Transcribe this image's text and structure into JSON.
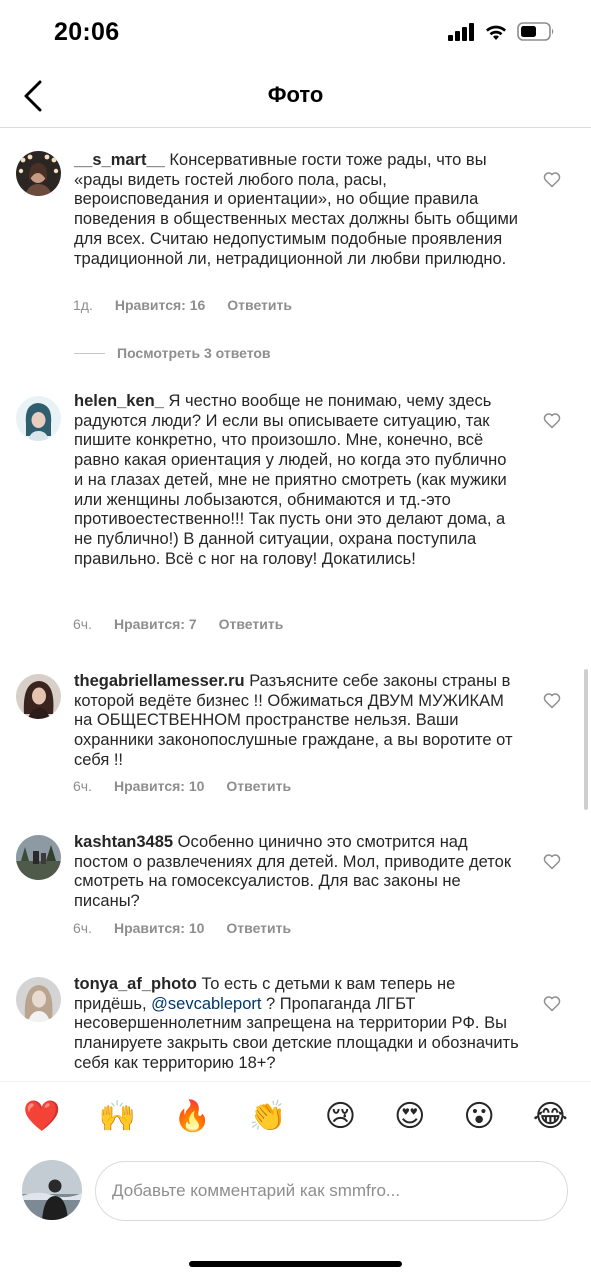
{
  "status_bar": {
    "time": "20:06"
  },
  "header": {
    "title": "Фото"
  },
  "comments": [
    {
      "username": "__s_mart__",
      "text": "Консервативные гости тоже рады, что вы «рады видеть гостей любого пола, расы, вероисповедания и ориентации», но общие правила поведения в общественных местах должны быть общими для всех. Считаю недопустимым подобные проявления традиционной ли, нетрадиционной ли любви прилюдно.",
      "time": "1д.",
      "likes": "Нравится: 16",
      "reply": "Ответить"
    },
    {
      "username": "helen_ken_",
      "text": "Я честно вообще не понимаю, чему здесь радуются люди? И если вы описываете ситуацию, так пишите конкретно, что произошло. Мне, конечно, всё равно какая ориентация у людей, но когда это публично и на глазах детей, мне не приятно смотреть (как мужики или женщины лобызаются, обнимаются и тд.-это противоестественно!!! Так пусть они это делают дома, а не публично!) В данной ситуации, охрана поступила правильно. Всё с ног на голову! Докатились!",
      "time": "6ч.",
      "likes": "Нравится: 7",
      "reply": "Ответить"
    },
    {
      "username": "thegabriellamesser.ru",
      "text": "Разъясните себе законы страны в которой ведёте бизнес !! Обжиматься ДВУМ МУЖИКАМ на ОБЩЕСТВЕННОМ пространстве нельзя. Ваши охранники законопослушные граждане, а вы воротите от себя !!",
      "time": "6ч.",
      "likes": "Нравится: 10",
      "reply": "Ответить"
    },
    {
      "username": "kashtan3485",
      "text": "Особенно цинично это смотрится над постом о развлечениях для детей. Мол, приводите деток смотреть на гомосексуалистов. Для вас законы не писаны?",
      "time": "6ч.",
      "likes": "Нравится: 10",
      "reply": "Ответить"
    },
    {
      "username": "tonya_af_photo",
      "text_before": "То есть с детьми к вам теперь не придёшь, ",
      "mention": "@sevcableport",
      "text_after": " ? Пропаганда ЛГБТ несовершеннолетним запрещена на территории РФ. Вы планируете закрыть свои детские площадки и обозначить себя как территорию 18+?"
    }
  ],
  "view_replies": "Посмотреть 3 ответов",
  "reactions": [
    "❤️",
    "🙌",
    "🔥",
    "👏",
    "😢",
    "😍",
    "😮",
    "😂"
  ],
  "composer": {
    "placeholder": "Добавьте комментарий как smmfro..."
  },
  "icons": {
    "back": "chevron-left-icon",
    "heart": "heart-outline-icon",
    "signal": "signal-icon",
    "wifi": "wifi-icon",
    "battery": "battery-icon"
  }
}
